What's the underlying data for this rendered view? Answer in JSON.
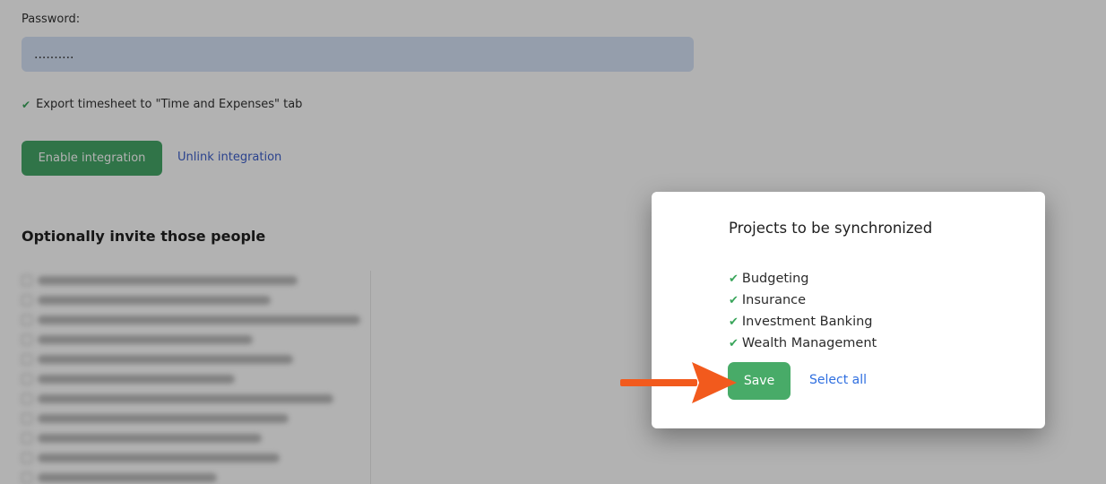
{
  "background": {
    "password_label": "Password:",
    "password_value": "..........",
    "export_label": "Export timesheet to \"Time and Expenses\" tab",
    "enable_button": "Enable integration",
    "unlink_link": "Unlink integration",
    "invite_title": "Optionally invite those people"
  },
  "modal": {
    "title": "Projects to be synchronized",
    "projects": [
      "Budgeting",
      "Insurance",
      "Investment Banking",
      "Wealth Management"
    ],
    "save_label": "Save",
    "select_all_label": "Select all"
  },
  "colors": {
    "accent_green": "#48ab68",
    "link_blue": "#2f6fe0",
    "arrow_orange": "#f25a1d"
  },
  "icons": {
    "check": "checkmark-icon",
    "annotation": "arrow-right-icon"
  }
}
